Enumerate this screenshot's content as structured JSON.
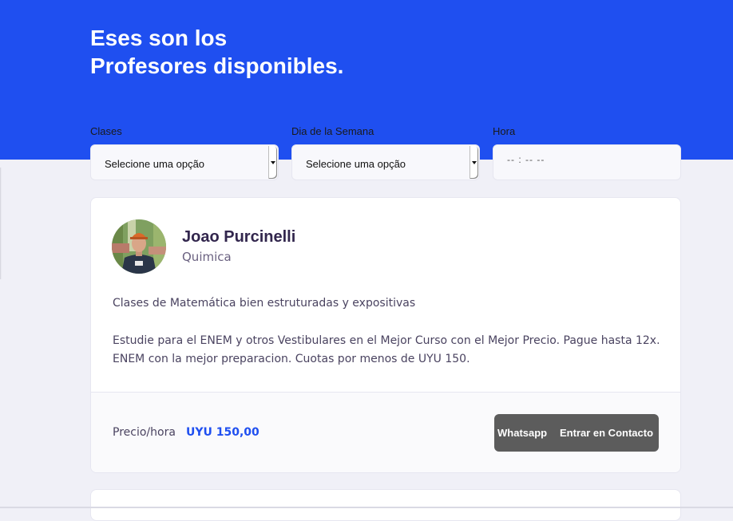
{
  "header": {
    "title_line1": "Eses son los",
    "title_line2": "Profesores disponibles."
  },
  "filters": {
    "clases": {
      "label": "Clases",
      "value": "Selecione uma opção"
    },
    "dia": {
      "label": "Dia de la Semana",
      "value": "Selecione uma opção"
    },
    "hora": {
      "label": "Hora",
      "value": "-- : --   --"
    }
  },
  "teacher": {
    "name": "Joao Purcinelli",
    "subject": "Quimica",
    "bio_line1": "Clases de Matemática bien estruturadas y expositivas",
    "bio_line2": "Estudie para el ENEM y otros Vestibulares en el Mejor Curso con el Mejor Precio. Pague hasta 12x. ENEM con la mejor preparacion. Cuotas por menos de UYU 150.",
    "price_label": "Precio/hora",
    "price_value": "UYU 150,00",
    "button_whatsapp": "Whatsapp",
    "button_contact": "Entrar en Contacto"
  },
  "colors": {
    "primary": "#1F4FF0",
    "background": "#F0F0F7",
    "button": "#5C5C5C"
  }
}
